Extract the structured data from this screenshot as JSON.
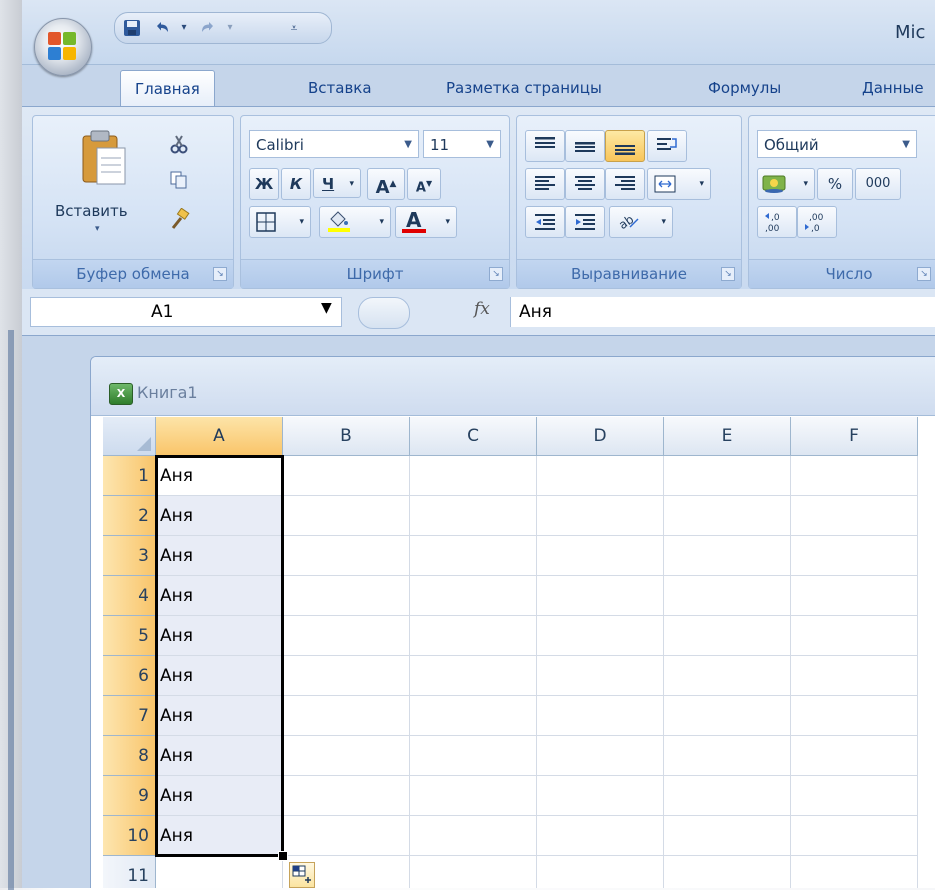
{
  "window": {
    "title": "Mic",
    "qat": {
      "save": "save-icon",
      "undo": "undo-icon",
      "redo": "redo-icon",
      "customize": "customize-icon"
    }
  },
  "tabs": [
    "Главная",
    "Вставка",
    "Разметка страницы",
    "Формулы",
    "Данные"
  ],
  "ribbon": {
    "clipboard": {
      "label": "Буфер обмена",
      "paste_label": "Вставить"
    },
    "font": {
      "label": "Шрифт",
      "font_name": "Calibri",
      "font_size": "11",
      "bold": "Ж",
      "italic": "К",
      "underline": "Ч",
      "grow": "A",
      "shrink": "A",
      "font_color": "A"
    },
    "alignment": {
      "label": "Выравнивание"
    },
    "number": {
      "label": "Число",
      "format": "Общий",
      "percent": "%",
      "thousands": "000"
    }
  },
  "formula_bar": {
    "name_box": "A1",
    "fx": "fx",
    "value": "Аня"
  },
  "workbook": {
    "title": "Книга1",
    "icon_text": "X",
    "columns": [
      "A",
      "B",
      "C",
      "D",
      "E",
      "F"
    ],
    "rows": [
      "1",
      "2",
      "3",
      "4",
      "5",
      "6",
      "7",
      "8",
      "9",
      "10",
      "11"
    ],
    "cells_a": [
      "Аня",
      "Аня",
      "Аня",
      "Аня",
      "Аня",
      "Аня",
      "Аня",
      "Аня",
      "Аня",
      "Аня",
      ""
    ]
  },
  "colors": {
    "accent": "#f8c55a",
    "ribbon": "#d5e3f5",
    "header_text": "#27415f"
  }
}
